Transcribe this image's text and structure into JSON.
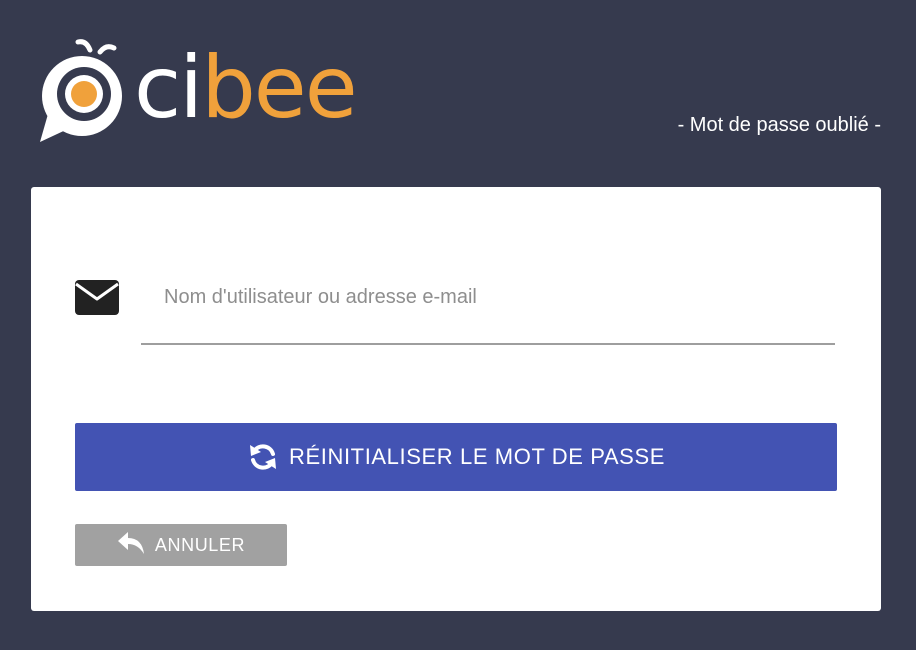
{
  "brand": {
    "name_part1": "ci",
    "name_part2": "bee",
    "colors": {
      "primary_text": "#ffffff",
      "accent": "#f0a13b",
      "background": "#363a4e"
    }
  },
  "header": {
    "subtitle": "- Mot de passe oublié -"
  },
  "form": {
    "email_icon": "envelope-icon",
    "username_placeholder": "Nom d'utilisateur ou adresse e-mail",
    "username_value": "",
    "reset_icon": "refresh-icon",
    "reset_label": "RÉINITIALISER LE MOT DE PASSE",
    "cancel_icon": "reply-arrow-icon",
    "cancel_label": "ANNULER",
    "colors": {
      "reset_button": "#4353b3",
      "cancel_button": "#a1a1a1"
    }
  }
}
